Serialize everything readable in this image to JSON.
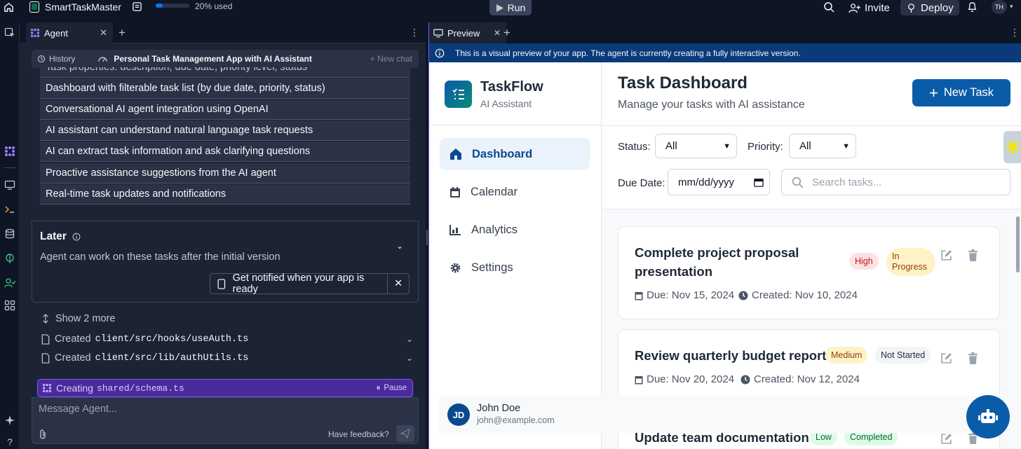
{
  "topbar": {
    "app_name": "SmartTaskMaster",
    "usage_text": "20% used",
    "usage_fraction": 0.2,
    "run_label": "Run",
    "invite_label": "Invite",
    "deploy_label": "Deploy",
    "avatar_initials": "TH"
  },
  "agent": {
    "tab_label": "Agent",
    "history_label": "History",
    "chat_title": "Personal Task Management App with AI Assistant",
    "new_chat_label": "New chat",
    "requirements": [
      "Task properties: description, due date, priority level, status",
      "Dashboard with filterable task list (by due date, priority, status)",
      "Conversational AI agent integration using OpenAI",
      "AI assistant can understand natural language task requests",
      "AI can extract task information and ask clarifying questions",
      "Proactive assistance suggestions from the AI agent",
      "Real-time task updates and notifications"
    ],
    "later_title": "Later",
    "later_desc": "Agent can work on these tasks after the initial version",
    "notify_label": "Get notified when your app is ready",
    "show_more": "Show 2 more",
    "created_prefix": "Created",
    "files": [
      "client/src/hooks/useAuth.ts",
      "client/src/lib/authUtils.ts"
    ],
    "creating_prefix": "Creating",
    "creating_file": "shared/schema.ts",
    "pause_label": "Pause",
    "message_placeholder": "Message Agent...",
    "feedback_label": "Have feedback?"
  },
  "preview": {
    "tab_label": "Preview",
    "banner": "This is a visual preview of your app. The agent is currently creating a fully interactive version.",
    "brand_name": "TaskFlow",
    "brand_sub": "AI Assistant",
    "nav": [
      "Dashboard",
      "Calendar",
      "Analytics",
      "Settings"
    ],
    "page_title": "Task Dashboard",
    "page_subtitle": "Manage your tasks with AI assistance",
    "new_task_label": "New Task",
    "status_label": "Status:",
    "status_value": "All",
    "priority_label": "Priority:",
    "priority_value": "All",
    "due_label": "Due Date:",
    "due_placeholder": "mm/dd/yyyy",
    "search_placeholder": "Search tasks...",
    "tasks": [
      {
        "title_line1": "Complete project proposal",
        "title_line2": "presentation",
        "priority": "High",
        "status_line1": "In",
        "status_line2": "Progress",
        "due": "Due: Nov 15, 2024",
        "created": "Created: Nov 10, 2024"
      },
      {
        "title_line1": "Review quarterly budget report",
        "priority": "Medium",
        "status_line1": "Not Started",
        "due": "Due: Nov 20, 2024",
        "created": "Created: Nov 12, 2024"
      },
      {
        "title_line1": "Update team documentation",
        "priority": "Low",
        "status_line1": "Completed"
      }
    ],
    "user_name": "John Doe",
    "user_email": "john@example.com",
    "user_initials": "JD"
  },
  "colors": {
    "accent": "#0b5ca8",
    "agent_purple": "#7c5cff",
    "bg_dark": "#0e1525"
  }
}
